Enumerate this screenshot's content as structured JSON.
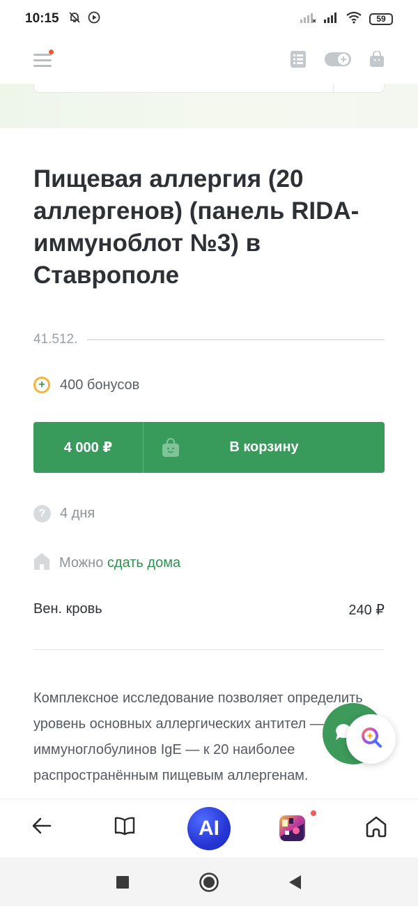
{
  "status_bar": {
    "time": "10:15",
    "battery": "59",
    "icons": [
      "mute-bell-icon",
      "play-circle-icon",
      "signal-off-icon",
      "signal-icon",
      "wifi-icon",
      "battery-icon"
    ]
  },
  "header": {
    "icons": [
      "menu-icon",
      "list-icon",
      "toggle-add-icon",
      "bag-icon"
    ],
    "accent_dot_color": "#f05a2a"
  },
  "product": {
    "title": "Пищевая аллергия (20 аллергенов) (панель RIDA-иммуноблот №3) в Ставрополе",
    "code": "41.512.",
    "bonus": "400 бонусов",
    "price": "4 000 ₽",
    "cart_label": "В корзину",
    "duration": "4 дня",
    "home_prefix": "Можно",
    "home_link": "сдать дома",
    "sample_name": "Вен. кровь",
    "sample_price": "240 ₽",
    "description": "Комплексное исследование позволяет определить уровень основных аллергических антител — иммуноглобулинов IgE — к 20 наиболее распространённым пищевым аллергенам."
  },
  "bottom_bar": {
    "ai_label": "AI",
    "icons": [
      "back-arrow-icon",
      "book-icon",
      "ai-assistant-icon",
      "game-app-icon",
      "home-icon"
    ]
  },
  "colors": {
    "brand_green": "#389a5b",
    "link_green": "#2f8f4e",
    "ai_blue": "#2636d6"
  }
}
